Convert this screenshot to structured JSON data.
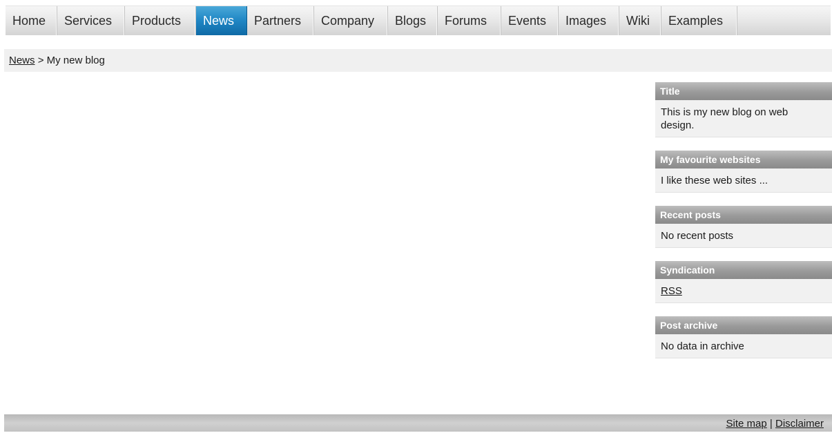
{
  "nav": {
    "items": [
      {
        "label": "Home"
      },
      {
        "label": "Services"
      },
      {
        "label": "Products"
      },
      {
        "label": "News"
      },
      {
        "label": "Partners"
      },
      {
        "label": "Company"
      },
      {
        "label": "Blogs"
      },
      {
        "label": "Forums"
      },
      {
        "label": "Events"
      },
      {
        "label": "Images"
      },
      {
        "label": "Wiki"
      },
      {
        "label": "Examples"
      }
    ],
    "active_label": "News"
  },
  "breadcrumb": {
    "link_label": "News",
    "separator": ">",
    "current": "My new blog"
  },
  "sidebar": {
    "boxes": [
      {
        "title": "Title",
        "body": "This is my new blog on web design."
      },
      {
        "title": "My favourite websites",
        "body": "I like these web sites ..."
      },
      {
        "title": "Recent posts",
        "body": "No recent posts"
      },
      {
        "title": "Syndication",
        "link": "RSS"
      },
      {
        "title": "Post archive",
        "body": "No data in archive"
      }
    ]
  },
  "footer": {
    "sitemap_label": "Site map",
    "separator": "|",
    "disclaimer_label": "Disclaimer"
  },
  "colors": {
    "active_tab": "#1f86c4",
    "box_header": "#9a9a9a",
    "panel_background": "#f1f1f1"
  }
}
